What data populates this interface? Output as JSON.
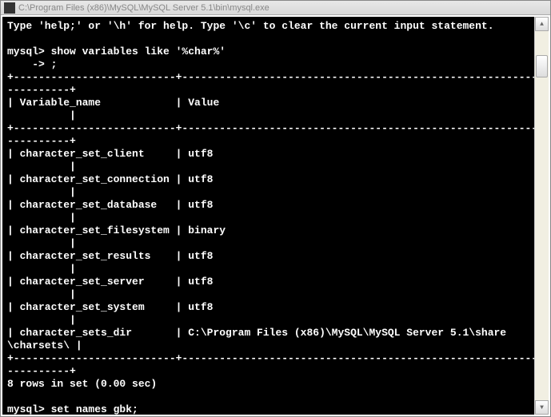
{
  "window": {
    "title": "C:\\Program Files (x86)\\MySQL\\MySQL Server 5.1\\bin\\mysql.exe"
  },
  "terminal": {
    "help_line": "Type 'help;' or '\\h' for help. Type '\\c' to clear the current input statement.",
    "prompt1": "mysql>",
    "cmd1": "show variables like '%char%'",
    "cont_prompt": "    ->",
    "cont_cmd": ";",
    "sep_top": "+--------------------------+---------------------------------------------------------+",
    "header_var": "Variable_name",
    "header_val": "Value",
    "rows": [
      {
        "name": "character_set_client",
        "value": "utf8"
      },
      {
        "name": "character_set_connection",
        "value": "utf8"
      },
      {
        "name": "character_set_database",
        "value": "utf8"
      },
      {
        "name": "character_set_filesystem",
        "value": "binary"
      },
      {
        "name": "character_set_results",
        "value": "utf8"
      },
      {
        "name": "character_set_server",
        "value": "utf8"
      },
      {
        "name": "character_set_system",
        "value": "utf8"
      },
      {
        "name": "character_sets_dir",
        "value": "C:\\Program Files (x86)\\MySQL\\MySQL Server 5.1\\share\\charsets\\"
      }
    ],
    "status": "8 rows in set (0.00 sec)",
    "prompt2": "mysql>",
    "cmd2": "set names gbk;"
  }
}
